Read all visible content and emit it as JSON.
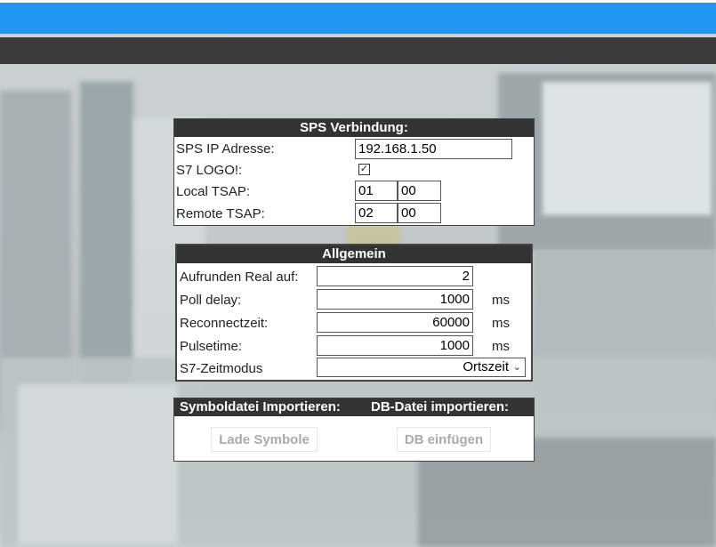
{
  "sps": {
    "title": "SPS Verbindung:",
    "ip_label": "SPS IP Adresse:",
    "ip_value": "192.168.1.50",
    "logo_label": "S7 LOGO!:",
    "logo_checked": true,
    "local_tsap_label": "Local TSAP:",
    "local_tsap_1": "01",
    "local_tsap_2": "00",
    "remote_tsap_label": "Remote TSAP:",
    "remote_tsap_1": "02",
    "remote_tsap_2": "00"
  },
  "allgemein": {
    "title": "Allgemein",
    "round_label": "Aufrunden Real auf:",
    "round_value": "2",
    "poll_label": "Poll delay:",
    "poll_value": "1000",
    "poll_unit": "ms",
    "reconnect_label": "Reconnectzeit:",
    "reconnect_value": "60000",
    "reconnect_unit": "ms",
    "pulse_label": "Pulsetime:",
    "pulse_value": "1000",
    "pulse_unit": "ms",
    "zeit_label": "S7-Zeitmodus",
    "zeit_value": "Ortszeit"
  },
  "import": {
    "symbol_header": "Symboldatei Importieren:",
    "db_header": "DB-Datei importieren:",
    "symbol_button": "Lade Symbole",
    "db_button": "DB einfügen"
  },
  "colors": {
    "topbar": "#2196f3",
    "darkbar": "#3a3a3a",
    "panel_header": "#333333"
  }
}
